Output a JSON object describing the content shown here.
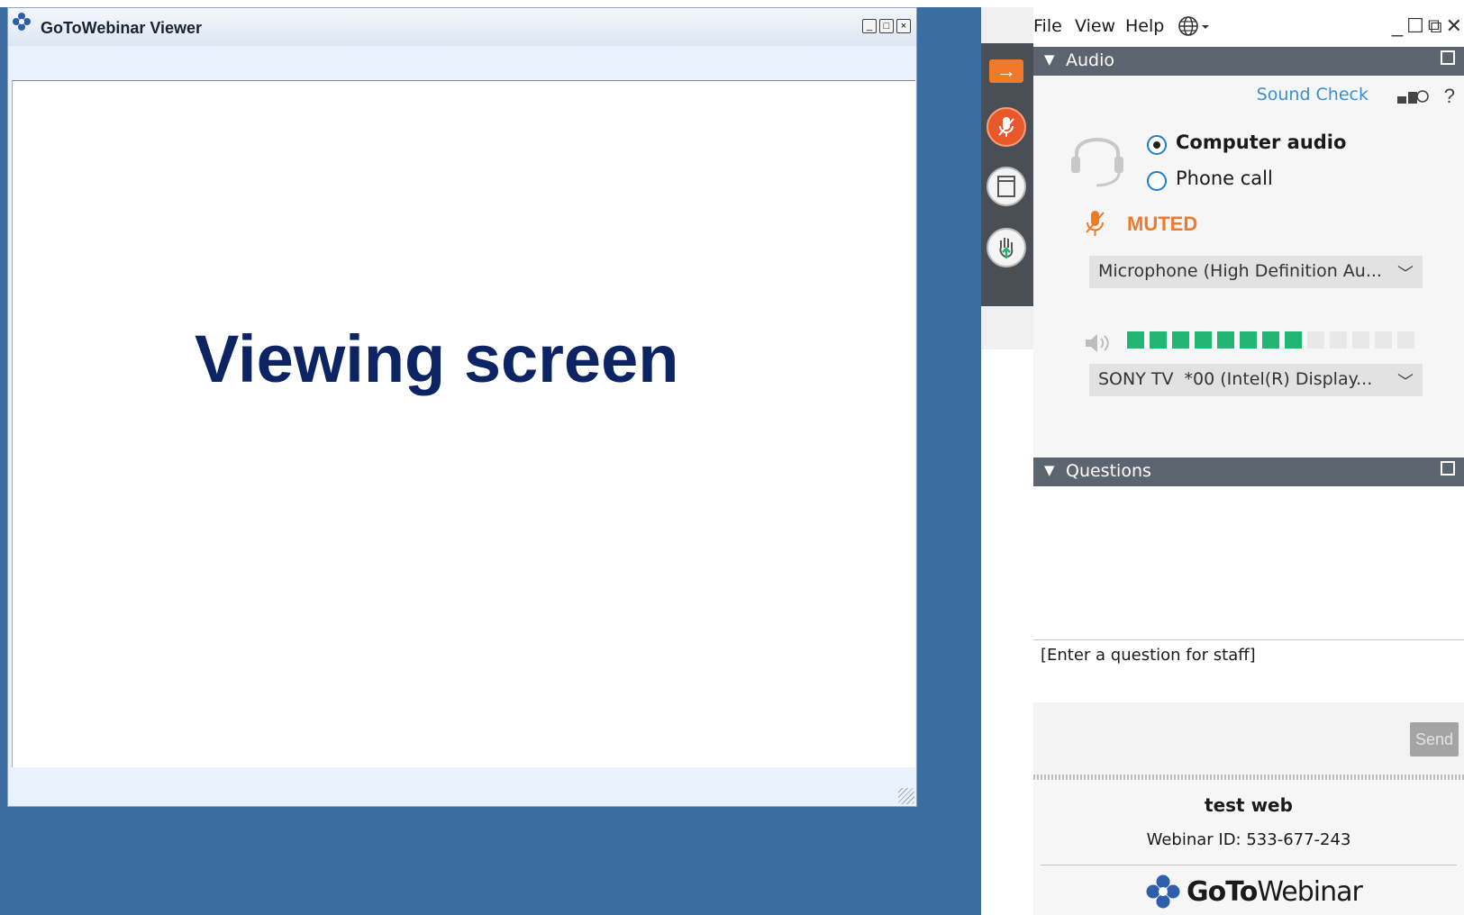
{
  "viewer": {
    "title": "GoToWebinar Viewer",
    "win_buttons": [
      "_",
      "□",
      "×"
    ],
    "screen_text": "Viewing screen"
  },
  "menubar": {
    "items": [
      "File",
      "View",
      "Help"
    ],
    "globe_icon": "globe-icon",
    "controls": [
      "_",
      "☐",
      "⧉",
      "✕"
    ]
  },
  "audio": {
    "section_title": "Audio",
    "sound_check": "Sound Check",
    "help": "?",
    "options": {
      "computer": "Computer audio",
      "phone": "Phone call",
      "selected": "Computer audio"
    },
    "status": "MUTED",
    "microphone": "Microphone (High Definition Au...",
    "speaker": "SONY TV  *00 (Intel(R) Display...",
    "speaker_level": 8,
    "speaker_level_max": 13,
    "accent_color": "#f07a2a",
    "level_color": "#22b573"
  },
  "questions": {
    "section_title": "Questions",
    "placeholder": "[Enter a question for staff]",
    "send_label": "Send"
  },
  "footer": {
    "title": "test web",
    "webinar_id": "Webinar ID: 533-677-243",
    "brand_bold": "GoTo",
    "brand_rest": "Webinar"
  }
}
